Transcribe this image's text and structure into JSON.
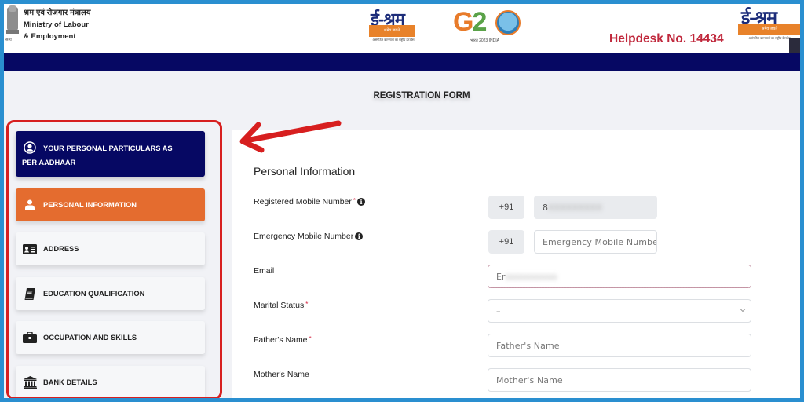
{
  "header": {
    "ministry_hindi": "श्रम एवं रोजगार मंत्रालय",
    "ministry_line1": "Ministry of Labour",
    "ministry_line2": "& Employment",
    "emblem_caption": "सत्यमेव जयते",
    "eshram_title": "ई-श्रम",
    "eshram_band": "श्रमेव जयते",
    "eshram_tagline": "असंगठित कामगारों का राष्ट्रीय डेटाबेस",
    "g20_text_g": "G2",
    "g20_text_0": "",
    "g20_sub": "भारत 2023 INDIA",
    "helpdesk": "Helpdesk No. 14434"
  },
  "page": {
    "title": "REGISTRATION FORM"
  },
  "sidebar": {
    "items": [
      {
        "label": "YOUR PERSONAL PARTICULARS AS PER AADHAAR",
        "icon": "user-circle-icon",
        "state": "header"
      },
      {
        "label": "PERSONAL INFORMATION",
        "icon": "user-icon",
        "state": "active"
      },
      {
        "label": "ADDRESS",
        "icon": "address-card-icon",
        "state": "default"
      },
      {
        "label": "EDUCATION QUALIFICATION",
        "icon": "book-icon",
        "state": "default"
      },
      {
        "label": "OCCUPATION AND SKILLS",
        "icon": "briefcase-icon",
        "state": "default"
      },
      {
        "label": "BANK DETAILS",
        "icon": "bank-icon",
        "state": "default"
      }
    ]
  },
  "form": {
    "section_title": "Personal Information",
    "fields": {
      "registered_mobile": {
        "label": "Registered Mobile Number",
        "required": "*",
        "prefix": "+91",
        "value": "8",
        "masked_value": "XXXXXXXXX"
      },
      "emergency_mobile": {
        "label": "Emergency Mobile Number",
        "prefix": "+91",
        "placeholder": "Emergency Mobile Number"
      },
      "email": {
        "label": "Email",
        "value": "Er",
        "masked_value": "xxxxxxxxxx"
      },
      "marital_status": {
        "label": "Marital Status",
        "required": "*",
        "selected": "–"
      },
      "fathers_name": {
        "label": "Father's Name",
        "required": "*",
        "placeholder": "Father's Name"
      },
      "mothers_name": {
        "label": "Mother's Name",
        "placeholder": "Mother's Name"
      }
    }
  },
  "annotation": {
    "arrow_color": "#d71f1f",
    "highlight_color": "#d71f1f"
  },
  "colors": {
    "navy": "#060863",
    "orange": "#e46c2f",
    "helpdesk_red": "#c0283c",
    "frame_blue": "#2a8fd0"
  }
}
